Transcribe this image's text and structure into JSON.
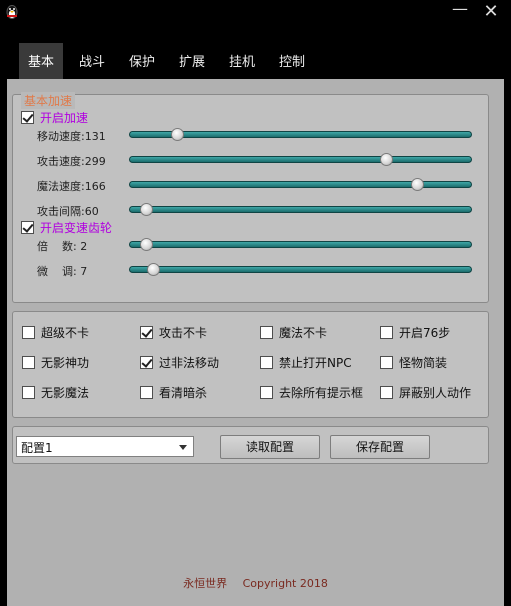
{
  "titlebar": {
    "min_glyph": "—",
    "close_glyph": "✕"
  },
  "tabs": [
    {
      "label": "基本",
      "active": true
    },
    {
      "label": "战斗",
      "active": false
    },
    {
      "label": "保护",
      "active": false
    },
    {
      "label": "扩展",
      "active": false
    },
    {
      "label": "挂机",
      "active": false
    },
    {
      "label": "控制",
      "active": false
    }
  ],
  "basic_group": {
    "title": "基本加速",
    "speed_enable": {
      "label": "开启加速",
      "checked": true
    },
    "sliders": [
      {
        "label": "移动速度:131",
        "value_fraction": 0.14
      },
      {
        "label": "攻击速度:299",
        "value_fraction": 0.76
      },
      {
        "label": "魔法速度:166",
        "value_fraction": 0.84
      },
      {
        "label": "攻击间隔:60",
        "value_fraction": 0.05
      }
    ],
    "gear_enable": {
      "label": "开启变速齿轮",
      "checked": true
    },
    "gear_sliders": [
      {
        "label": "倍    数: 2",
        "value_fraction": 0.05
      },
      {
        "label": "微    调: 7",
        "value_fraction": 0.07
      }
    ]
  },
  "options": [
    {
      "label": "超级不卡",
      "checked": false
    },
    {
      "label": "攻击不卡",
      "checked": true
    },
    {
      "label": "魔法不卡",
      "checked": false
    },
    {
      "label": "开启76步",
      "checked": false
    },
    {
      "label": "无影神功",
      "checked": false
    },
    {
      "label": "过非法移动",
      "checked": true
    },
    {
      "label": "禁止打开NPC",
      "checked": false
    },
    {
      "label": "怪物简装",
      "checked": false
    },
    {
      "label": "无影魔法",
      "checked": false
    },
    {
      "label": "看清暗杀",
      "checked": false
    },
    {
      "label": "去除所有提示框",
      "checked": false
    },
    {
      "label": "屏蔽别人动作",
      "checked": false
    }
  ],
  "config": {
    "selected": "配置1",
    "read_label": "读取配置",
    "save_label": "保存配置"
  },
  "footer": {
    "left": "永恒世界",
    "right": "Copyright 2018"
  }
}
